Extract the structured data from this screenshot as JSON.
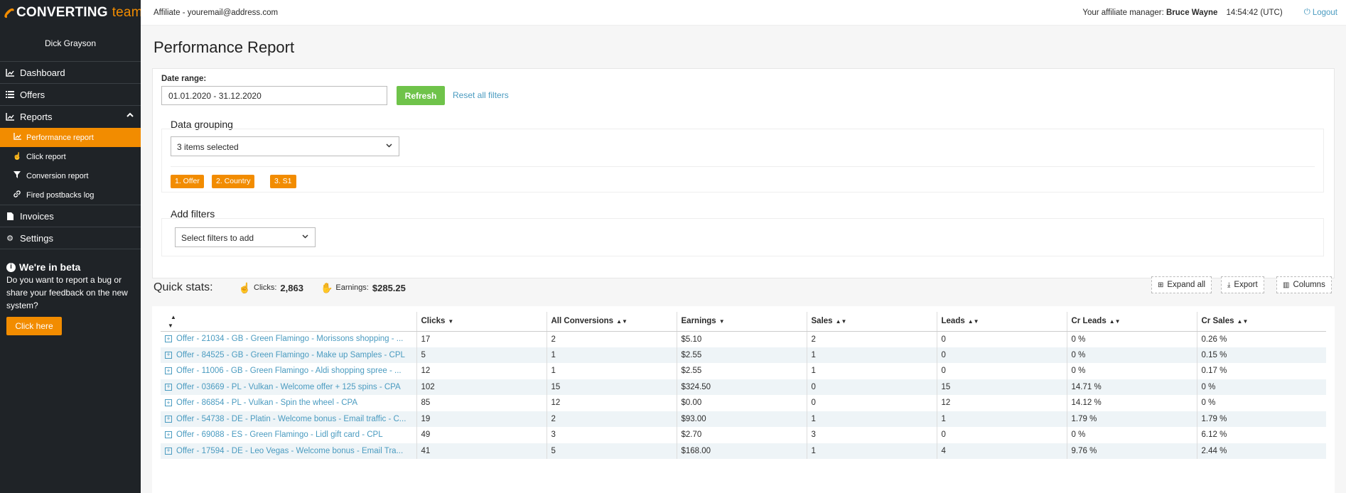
{
  "brand": {
    "name": "CONVERTING",
    "suffix": "team"
  },
  "sidebar": {
    "user": "Dick Grayson",
    "items": [
      {
        "label": "Dashboard",
        "icon": "chart-icon"
      },
      {
        "label": "Offers",
        "icon": "list-icon"
      },
      {
        "label": "Reports",
        "icon": "chart-icon"
      }
    ],
    "subitems": [
      {
        "label": "Performance report",
        "icon": "chart-icon",
        "active": true
      },
      {
        "label": "Click report",
        "icon": "pointer-icon"
      },
      {
        "label": "Conversion report",
        "icon": "filter-icon"
      },
      {
        "label": "Fired postbacks log",
        "icon": "link-icon"
      }
    ],
    "items2": [
      {
        "label": "Invoices",
        "icon": "file-icon"
      },
      {
        "label": "Settings",
        "icon": "gear-icon"
      }
    ],
    "beta": {
      "title": "We're in beta",
      "text": "Do you want to report a bug or share your feedback on the new system?",
      "button": "Click here"
    }
  },
  "topbar": {
    "affiliate": "Affiliate - youremail@address.com",
    "manager_label": "Your affiliate manager:",
    "manager": "Bruce Wayne",
    "time": "14:54:42 (UTC)",
    "logout": "Logout"
  },
  "page": {
    "title": "Performance Report"
  },
  "filters": {
    "date_label": "Date range:",
    "date_value": "01.01.2020 - 31.12.2020",
    "refresh": "Refresh",
    "reset": "Reset all filters",
    "grouping_label": "Data grouping",
    "grouping_value": "3 items selected",
    "tags": [
      "1. Offer",
      "2. Country",
      "3. S1"
    ],
    "add_filters_label": "Add filters",
    "add_filters_placeholder": "Select filters to add"
  },
  "quick_stats": {
    "label": "Quick stats:",
    "clicks_label": "Clicks:",
    "clicks": "2,863",
    "earnings_label": "Earnings:",
    "earnings": "$285.25"
  },
  "toolbar": {
    "expand": "Expand all",
    "export": "Export",
    "columns": "Columns"
  },
  "table": {
    "headers": [
      "",
      "Clicks",
      "All Conversions",
      "Earnings",
      "Sales",
      "Leads",
      "Cr Leads",
      "Cr Sales"
    ],
    "rows": [
      [
        "Offer - 21034 - GB - Green Flamingo - Morissons shopping - ...",
        "17",
        "2",
        "$5.10",
        "2",
        "0",
        "0 %",
        "0.26 %"
      ],
      [
        "Offer - 84525 - GB - Green Flamingo - Make up Samples - CPL",
        "5",
        "1",
        "$2.55",
        "1",
        "0",
        "0 %",
        "0.15 %"
      ],
      [
        "Offer - 11006 - GB - Green Flamingo - Aldi shopping spree - ...",
        "12",
        "1",
        "$2.55",
        "1",
        "0",
        "0 %",
        "0.17 %"
      ],
      [
        "Offer - 03669 - PL - Vulkan - Welcome offer + 125 spins - CPA",
        "102",
        "15",
        "$324.50",
        "0",
        "15",
        "14.71 %",
        "0 %"
      ],
      [
        "Offer - 86854 - PL - Vulkan - Spin the wheel - CPA",
        "85",
        "12",
        "$0.00",
        "0",
        "12",
        "14.12 %",
        "0 %"
      ],
      [
        "Offer - 54738 - DE - Platin - Welcome bonus - Email traffic - C...",
        "19",
        "2",
        "$93.00",
        "1",
        "1",
        "1.79 %",
        "1.79 %"
      ],
      [
        "Offer - 69088 - ES - Green Flamingo - Lidl gift card - CPL",
        "49",
        "3",
        "$2.70",
        "3",
        "0",
        "0 %",
        "6.12 %"
      ],
      [
        "Offer - 17594 - DE - Leo Vegas - Welcome bonus - Email Tra...",
        "41",
        "5",
        "$168.00",
        "1",
        "4",
        "9.76 %",
        "2.44 %"
      ]
    ]
  },
  "colors": {
    "accent": "#f28c00",
    "sidebar": "#1f2327",
    "link": "#4a9bc0",
    "refresh": "#6fc34a"
  }
}
